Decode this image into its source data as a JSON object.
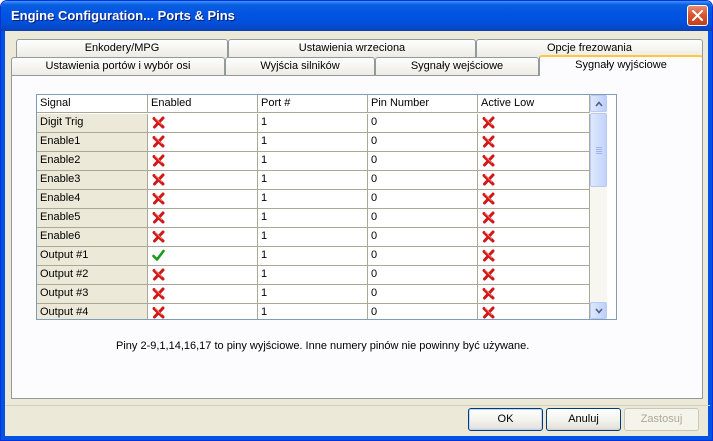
{
  "window": {
    "title": "Engine Configuration... Ports & Pins"
  },
  "tabs_row1": [
    "Enkodery/MPG",
    "Ustawienia wrzeciona",
    "Opcje frezowania"
  ],
  "tabs_row2": [
    "Ustawienia portów i wybór osi",
    "Wyjścia silników",
    "Sygnały wejściowe",
    "Sygnały wyjściowe"
  ],
  "active_tab": "Sygnały wyjściowe",
  "grid": {
    "columns": [
      "Signal",
      "Enabled",
      "Port #",
      "Pin Number",
      "Active Low"
    ],
    "rows": [
      {
        "signal": "Digit  Trig",
        "enabled": false,
        "port": "1",
        "pin": "0",
        "active_low": false
      },
      {
        "signal": "Enable1",
        "enabled": false,
        "port": "1",
        "pin": "0",
        "active_low": false
      },
      {
        "signal": "Enable2",
        "enabled": false,
        "port": "1",
        "pin": "0",
        "active_low": false
      },
      {
        "signal": "Enable3",
        "enabled": false,
        "port": "1",
        "pin": "0",
        "active_low": false
      },
      {
        "signal": "Enable4",
        "enabled": false,
        "port": "1",
        "pin": "0",
        "active_low": false
      },
      {
        "signal": "Enable5",
        "enabled": false,
        "port": "1",
        "pin": "0",
        "active_low": false
      },
      {
        "signal": "Enable6",
        "enabled": false,
        "port": "1",
        "pin": "0",
        "active_low": false
      },
      {
        "signal": "Output #1",
        "enabled": true,
        "port": "1",
        "pin": "0",
        "active_low": false
      },
      {
        "signal": "Output #2",
        "enabled": false,
        "port": "1",
        "pin": "0",
        "active_low": false
      },
      {
        "signal": "Output #3",
        "enabled": false,
        "port": "1",
        "pin": "0",
        "active_low": false
      },
      {
        "signal": "Output #4",
        "enabled": false,
        "port": "1",
        "pin": "0",
        "active_low": false
      }
    ]
  },
  "note": "Piny 2-9,1,14,16,17 to piny wyjściowe. Inne numery pinów nie powinny być używane.",
  "buttons": {
    "ok": "OK",
    "cancel": "Anuluj",
    "apply": "Zastosuj"
  },
  "colors": {
    "title_bar": "#0054e3",
    "cross": "#d01818",
    "check": "#1a9a1a"
  }
}
